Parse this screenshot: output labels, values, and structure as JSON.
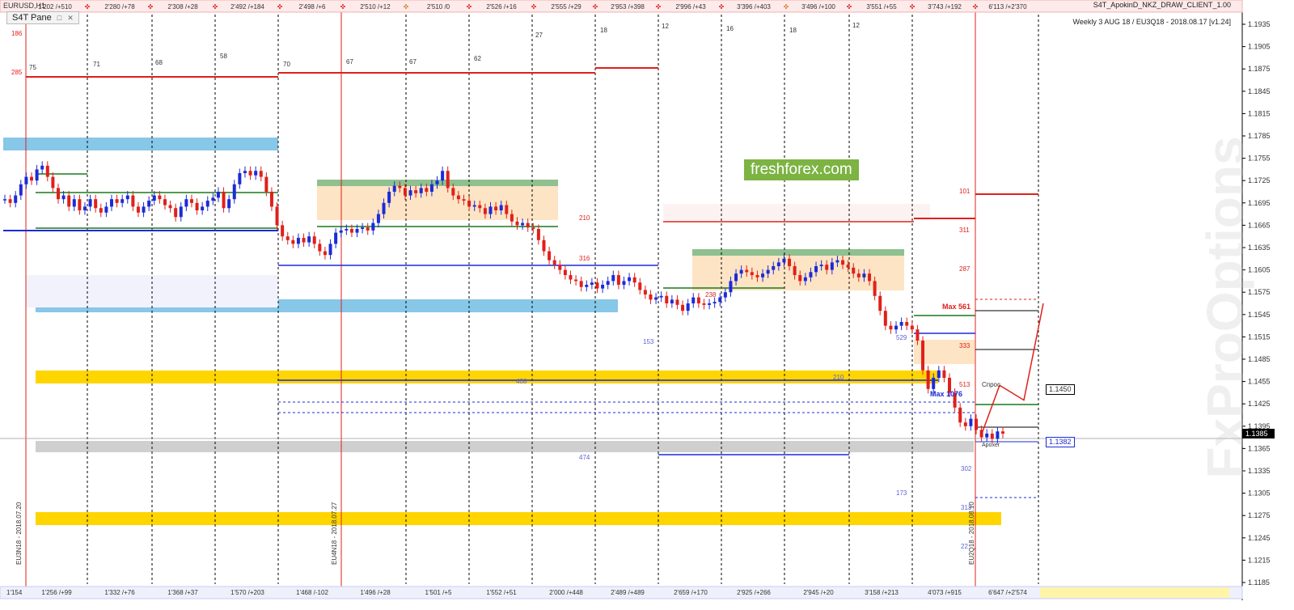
{
  "window": {
    "symbol": "EURUSD,H1",
    "pane_label": "S4T Pane",
    "indicator_title": "S4T_ApokinD_NKZ_DRAW_CLIENT_1.00",
    "subtitle": "Weekly 3 AUG 18 / EU3Q18 - 2018.08.17 [v1.24]",
    "watermark": "freshforex.com",
    "watermark2": "FxProOptions"
  },
  "icons": {
    "restore": "restore-icon",
    "close": "close-icon"
  },
  "colors": {
    "bull": "#1c2bd6",
    "bear": "#e0201a",
    "grid": "#000000",
    "accent": "#7cb342"
  },
  "chart_data": {
    "type": "line",
    "title": "Weekly 3 AUG 18 / EU3Q18 - 2018.08.17 [v1.24]",
    "ylim": [
      1.1185,
      1.1935
    ],
    "yticks": [
      "1.1935",
      "1.1905",
      "1.1875",
      "1.1845",
      "1.1815",
      "1.1785",
      "1.1755",
      "1.1725",
      "1.1695",
      "1.1665",
      "1.1635",
      "1.1605",
      "1.1575",
      "1.1545",
      "1.1515",
      "1.1485",
      "1.1455",
      "1.1425",
      "1.1395",
      "1.1365",
      "1.1335",
      "1.1305",
      "1.1275",
      "1.1245",
      "1.1215",
      "1.1185"
    ],
    "current_price": "1.1385",
    "price_labels": [
      "1.1450",
      "1.1382"
    ],
    "top_labels": [
      "1'202 / +510",
      "2'280 / +78",
      "2'308 / +28",
      "2'492 / +184",
      "2'498 / +6",
      "2'510 / +12",
      "2'510 / 0",
      "2'526 / +16",
      "2'555 / +29",
      "2'953 / +398",
      "2'996 / +43",
      "3'396 / +403",
      "3'496 / +100",
      "3'551 / +55",
      "3'743 / +192",
      "6'113 / +2'370"
    ],
    "bottom_labels": [
      "1'154",
      "1'256 / +99",
      "1'332 / +76",
      "1'368 / +37",
      "1'570 / +203",
      "1'468 / -102",
      "1'496 / +28",
      "1'501 / +5",
      "1'552 / +51",
      "2'000 / +448",
      "2'489 / +489",
      "2'659 / +170",
      "2'925 / +266",
      "2'945 / +20",
      "3'158 / +213",
      "4'073 / +915",
      "6'647 / +2'574"
    ],
    "week_labels": [
      "EU3N18 - 2018.07.20",
      "EU4N18 - 2018.07.27",
      "EU2Q18 - 2018.08.10"
    ],
    "small_numbers": [
      "186",
      "285",
      "75",
      "71",
      "68",
      "58",
      "70",
      "67",
      "67",
      "62",
      "27",
      "18",
      "12",
      "16",
      "18",
      "12"
    ],
    "level_labels": [
      "101",
      "311",
      "287",
      "333",
      "513",
      "302",
      "313",
      "22",
      "210",
      "316",
      "238",
      "153",
      "529",
      "210",
      "408",
      "474",
      "173"
    ],
    "max_labels": [
      "Max 561",
      "Max 1076"
    ],
    "zone_label": "Спрос",
    "close_label": "Apoxer",
    "series": [
      {
        "values": [
          1.17,
          1.1695,
          1.1705,
          1.172,
          1.173,
          1.1725,
          1.174,
          1.1745,
          1.173,
          1.1715,
          1.17,
          1.1705,
          1.169,
          1.17,
          1.1685,
          1.169,
          1.17,
          1.1688,
          1.1682,
          1.169,
          1.17,
          1.1695,
          1.17,
          1.1705,
          1.169,
          1.1682,
          1.169,
          1.1698,
          1.1705,
          1.17,
          1.1692,
          1.1688,
          1.1676,
          1.169,
          1.17,
          1.1695,
          1.1685,
          1.169,
          1.1698,
          1.1702,
          1.171,
          1.1688,
          1.17,
          1.172,
          1.1735,
          1.1738,
          1.1732,
          1.1738,
          1.173,
          1.171,
          1.169,
          1.1665,
          1.165,
          1.1645,
          1.164,
          1.1648,
          1.1642,
          1.165,
          1.164,
          1.163,
          1.1625,
          1.164,
          1.1655,
          1.1658,
          1.166,
          1.1655,
          1.166,
          1.1662,
          1.1658,
          1.1668,
          1.168,
          1.1695,
          1.171,
          1.1718,
          1.1715,
          1.1705,
          1.1712,
          1.1708,
          1.1715,
          1.171,
          1.172,
          1.1725,
          1.1738,
          1.1715,
          1.1705,
          1.17,
          1.1698,
          1.169,
          1.1692,
          1.1688,
          1.168,
          1.169,
          1.1685,
          1.1692,
          1.168,
          1.167,
          1.1665,
          1.1668,
          1.1662,
          1.166,
          1.1645,
          1.163,
          1.1618,
          1.1612,
          1.1605,
          1.1598,
          1.1592,
          1.159,
          1.1582,
          1.1585,
          1.1588,
          1.158,
          1.1585,
          1.159,
          1.1598,
          1.1585,
          1.159,
          1.1595,
          1.1588,
          1.1578,
          1.1572,
          1.1565,
          1.1568,
          1.157,
          1.156,
          1.1565,
          1.1558,
          1.155,
          1.156,
          1.1568,
          1.156,
          1.1558,
          1.156,
          1.1562,
          1.1568,
          1.1575,
          1.159,
          1.16,
          1.1605,
          1.1602,
          1.1598,
          1.1595,
          1.16,
          1.1605,
          1.161,
          1.1615,
          1.162,
          1.161,
          1.1598,
          1.159,
          1.1595,
          1.1602,
          1.161,
          1.1612,
          1.1605,
          1.1615,
          1.1618,
          1.1612,
          1.1608,
          1.16,
          1.1595,
          1.16,
          1.159,
          1.157,
          1.155,
          1.153,
          1.1525,
          1.153,
          1.1535,
          1.153,
          1.1525,
          1.151,
          1.147,
          1.1445,
          1.146,
          1.147,
          1.146,
          1.144,
          1.142,
          1.14,
          1.1395,
          1.1405,
          1.139,
          1.138,
          1.1385,
          1.1378,
          1.1388,
          1.1385
        ]
      }
    ],
    "forecast": [
      1.1385,
      1.145,
      1.143,
      1.156
    ]
  }
}
